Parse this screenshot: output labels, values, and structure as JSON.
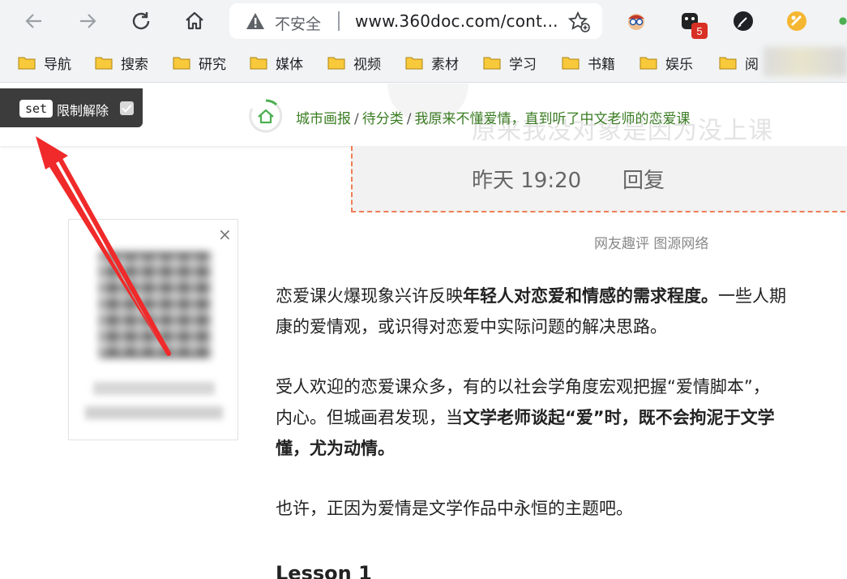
{
  "browser": {
    "url_insecure_label": "不安全",
    "url": "www.360doc.com/cont...",
    "extension_badge": "5"
  },
  "bookmarks": [
    {
      "label": "导航"
    },
    {
      "label": "搜索"
    },
    {
      "label": "研究"
    },
    {
      "label": "媒体"
    },
    {
      "label": "视频"
    },
    {
      "label": "素材"
    },
    {
      "label": "学习"
    },
    {
      "label": "书籍"
    },
    {
      "label": "娱乐"
    },
    {
      "label": "阅"
    }
  ],
  "overlay": {
    "set_label": "set",
    "limit_label": "限制解除"
  },
  "header": {
    "ghost_title": "原来我没对象是因为没上课",
    "breadcrumb": [
      "城市画报",
      "待分类",
      "我原来不懂爱情，直到听了中文老师的恋爱课"
    ]
  },
  "comment": {
    "time": "昨天 19:20",
    "reply": "回复"
  },
  "caption": "网友趣评  图源网络",
  "article": {
    "p1_a": "恋爱课火爆现象兴许反映",
    "p1_b": "年轻人对恋爱和情感的需求程度。",
    "p1_c": "一些人期",
    "p1_d": "康的爱情观，或识得对恋爱中实际问题的解决思路。",
    "p2_a": "受人欢迎的恋爱课众多，有的以社会学角度宏观把握“爱情脚本”，",
    "p2_b": "内心。但城画君发现，当",
    "p2_c": "文学老师谈起“爱”时，既不会拘泥于文学",
    "p2_d": "懂，尤为动情。",
    "p3": "也许，正因为爱情是文学作品中永恒的主题吧。",
    "lesson": "Lesson 1"
  }
}
